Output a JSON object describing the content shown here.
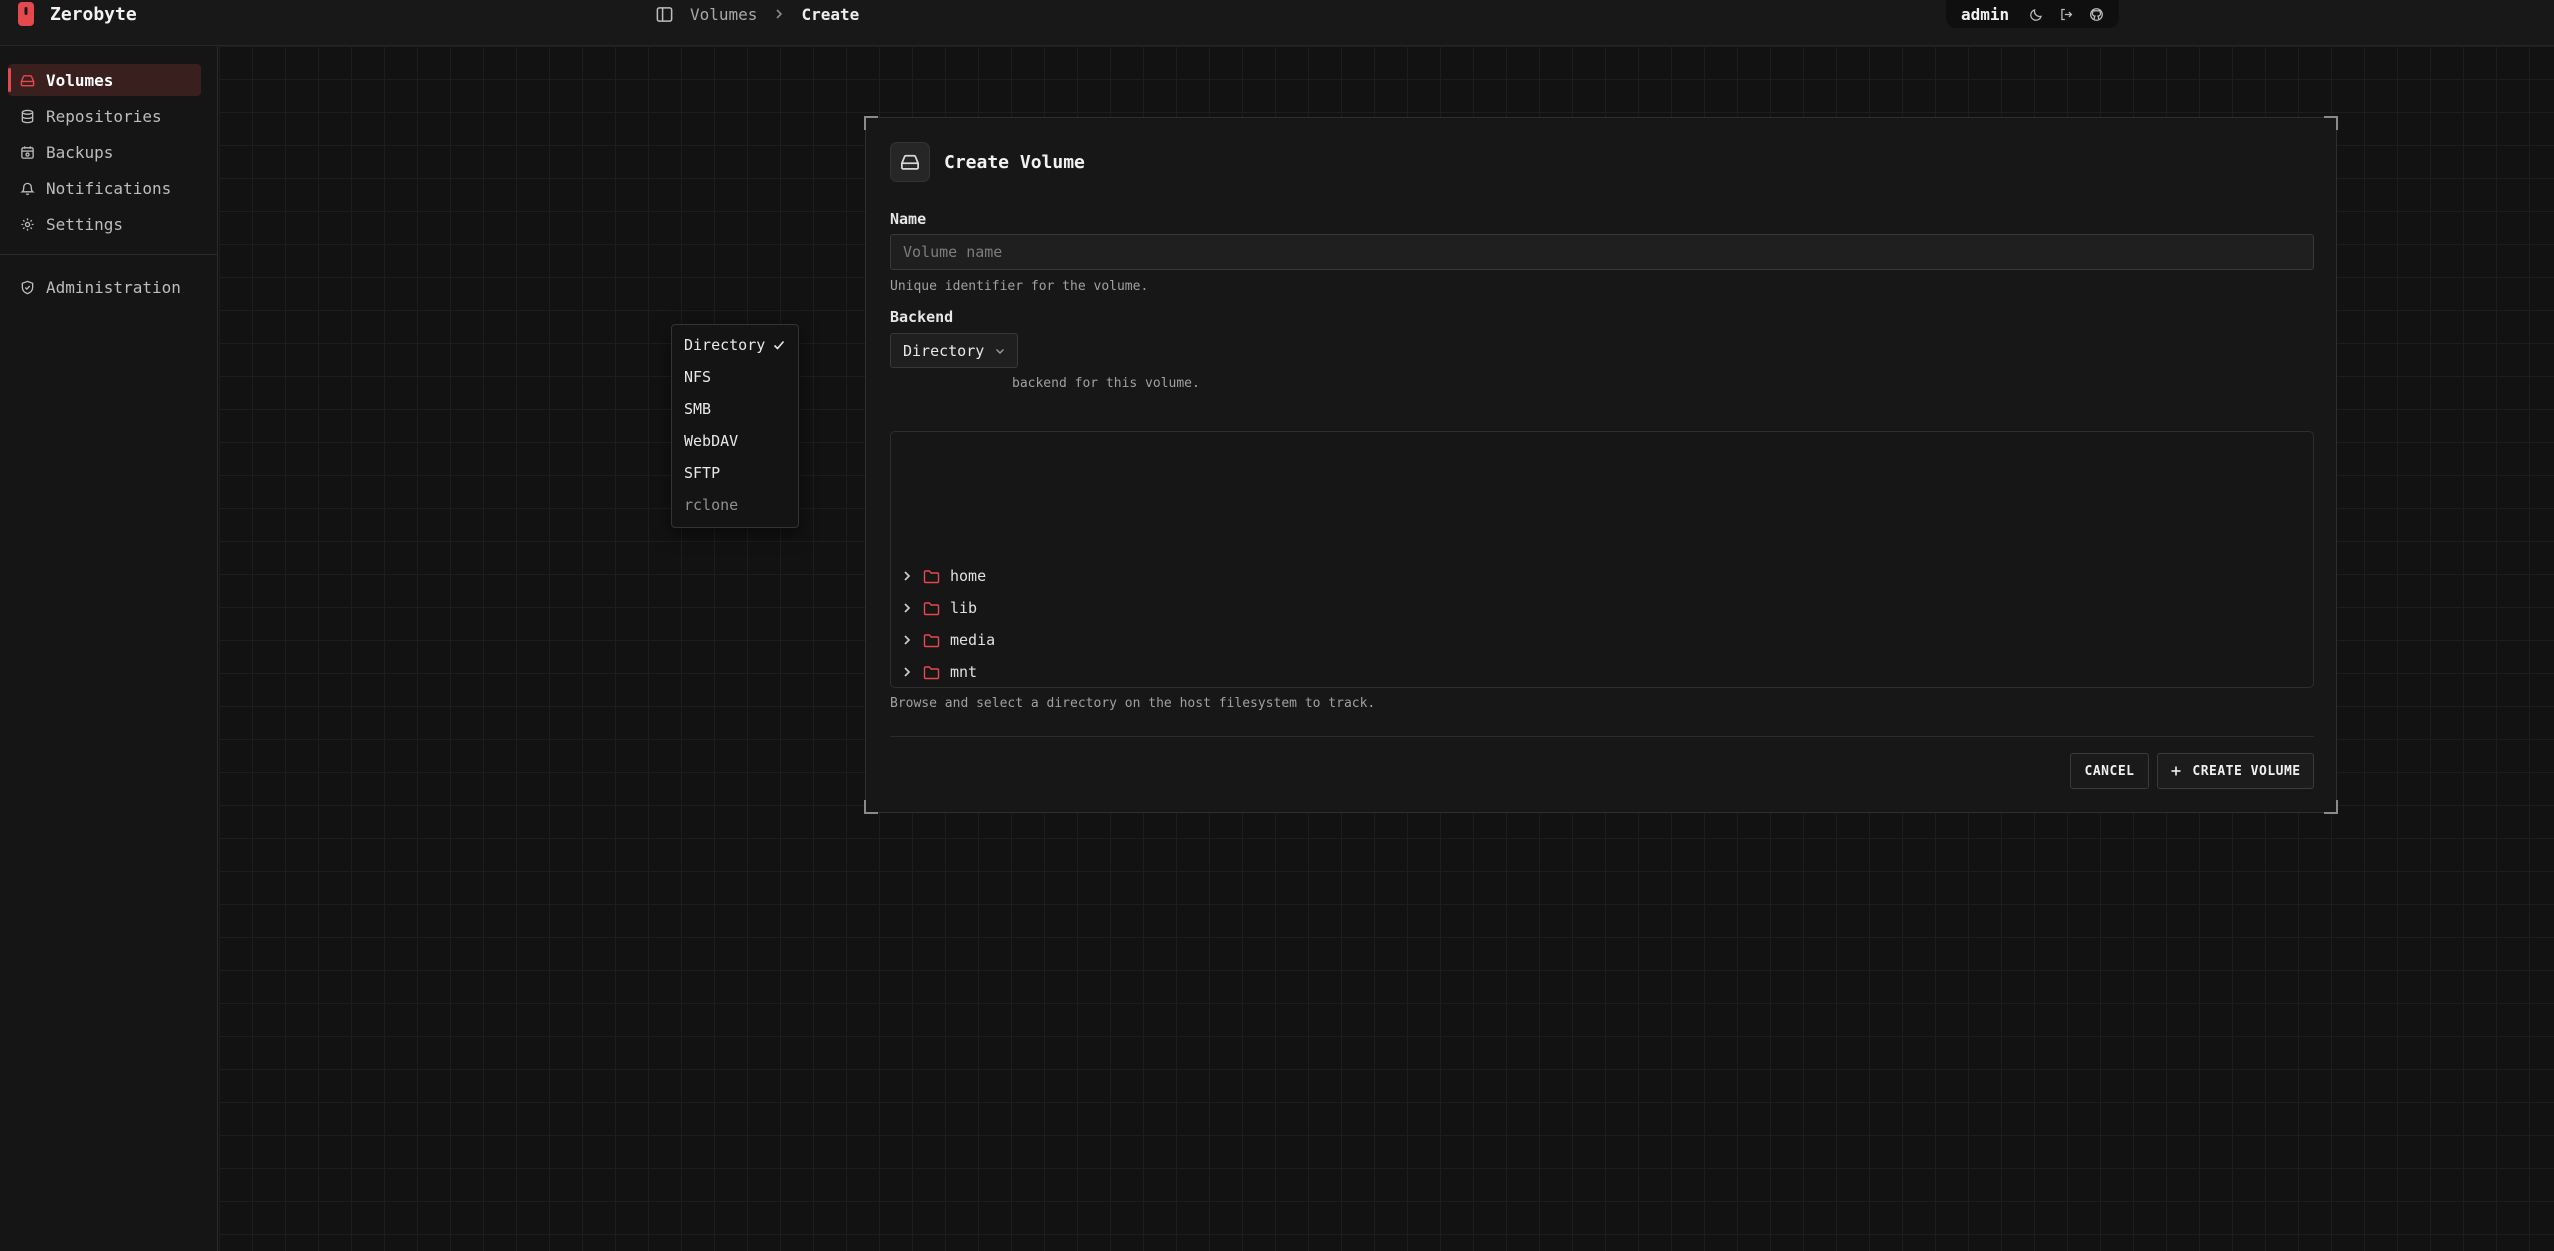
{
  "app": {
    "name": "Zerobyte"
  },
  "breadcrumb": {
    "items": [
      "Volumes",
      "Create"
    ]
  },
  "user": {
    "name": "admin"
  },
  "sidebar": {
    "items": [
      {
        "label": "Volumes",
        "icon": "hard-drive-icon",
        "active": true
      },
      {
        "label": "Repositories",
        "icon": "database-icon"
      },
      {
        "label": "Backups",
        "icon": "calendar-icon"
      },
      {
        "label": "Notifications",
        "icon": "bell-icon"
      },
      {
        "label": "Settings",
        "icon": "gear-icon"
      }
    ],
    "admin": {
      "label": "Administration",
      "icon": "shield-icon"
    }
  },
  "form": {
    "title": "Create Volume",
    "name_label": "Name",
    "name_placeholder": "Volume name",
    "name_value": "",
    "name_help": "Unique identifier for the volume.",
    "backend_label": "Backend",
    "backend_value": "Directory",
    "backend_help": "backend for this volume.",
    "backend_options": [
      {
        "label": "Directory",
        "selected": true
      },
      {
        "label": "NFS"
      },
      {
        "label": "SMB"
      },
      {
        "label": "WebDAV"
      },
      {
        "label": "SFTP"
      },
      {
        "label": "rclone",
        "disabled": true
      }
    ],
    "directory_rows": [
      "home",
      "lib",
      "media",
      "mnt"
    ],
    "directory_help": "Browse and select a directory on the host filesystem to track.",
    "cancel_label": "CANCEL",
    "create_label": "CREATE VOLUME"
  },
  "colors": {
    "accent": "#e5484d",
    "background": "#121212",
    "card": "#171717"
  }
}
